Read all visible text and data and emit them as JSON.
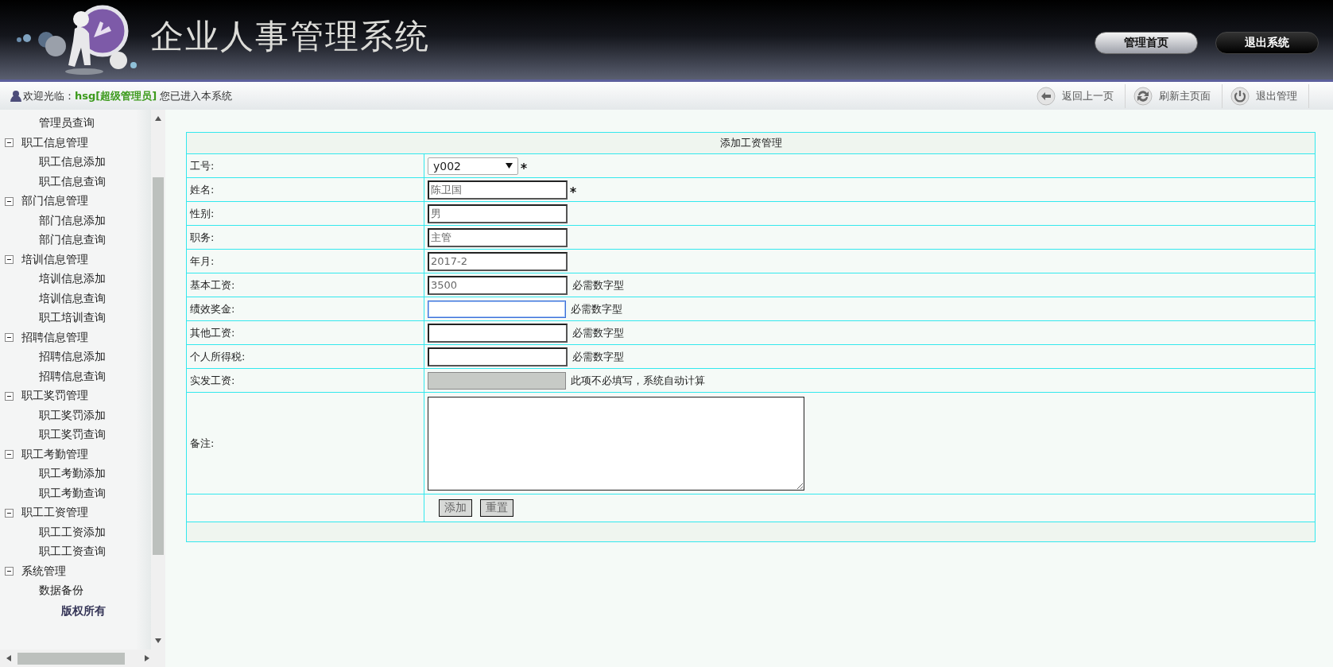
{
  "header": {
    "title": "企业人事管理系统",
    "nav_buttons": [
      {
        "label": "管理首页",
        "kind": "light"
      },
      {
        "label": "退出系统",
        "kind": "dark"
      }
    ]
  },
  "welcome": {
    "greeting": "欢迎光临：",
    "user": "hsg",
    "role": "[超级管理员]",
    "message": "您已进入本系统"
  },
  "toolbar": [
    {
      "label": "返回上一页"
    },
    {
      "label": "刷新主页面"
    },
    {
      "label": "退出管理"
    }
  ],
  "sidebar": {
    "tree": [
      {
        "children": [
          {
            "label": "管理员查询"
          }
        ]
      },
      {
        "label": "职工信息管理",
        "expanded": true,
        "children": [
          {
            "label": "职工信息添加"
          },
          {
            "label": "职工信息查询"
          }
        ]
      },
      {
        "label": "部门信息管理",
        "expanded": true,
        "children": [
          {
            "label": "部门信息添加"
          },
          {
            "label": "部门信息查询"
          }
        ]
      },
      {
        "label": "培训信息管理",
        "expanded": true,
        "children": [
          {
            "label": "培训信息添加"
          },
          {
            "label": "培训信息查询"
          },
          {
            "label": "职工培训查询"
          }
        ]
      },
      {
        "label": "招聘信息管理",
        "expanded": true,
        "children": [
          {
            "label": "招聘信息添加"
          },
          {
            "label": "招聘信息查询"
          }
        ]
      },
      {
        "label": "职工奖罚管理",
        "expanded": true,
        "children": [
          {
            "label": "职工奖罚添加"
          },
          {
            "label": "职工奖罚查询"
          }
        ]
      },
      {
        "label": "职工考勤管理",
        "expanded": true,
        "children": [
          {
            "label": "职工考勤添加"
          },
          {
            "label": "职工考勤查询"
          }
        ]
      },
      {
        "label": "职工工资管理",
        "expanded": true,
        "children": [
          {
            "label": "职工工资添加"
          },
          {
            "label": "职工工资查询"
          }
        ]
      },
      {
        "label": "系统管理",
        "expanded": true,
        "children": [
          {
            "label": "数据备份"
          }
        ]
      }
    ],
    "footer": "版权所有"
  },
  "form": {
    "title": "添加工资管理",
    "rows": [
      {
        "label": "工号:",
        "kind": "select",
        "value": "y002",
        "required": true
      },
      {
        "label": "姓名:",
        "kind": "text",
        "value": "陈卫国",
        "required": true,
        "focused": false
      },
      {
        "label": "性别:",
        "kind": "text",
        "value": "男",
        "required": false,
        "focused": false
      },
      {
        "label": "职务:",
        "kind": "text",
        "value": "主管",
        "required": false,
        "focused": false
      },
      {
        "label": "年月:",
        "kind": "text",
        "value": "2017-2",
        "required": false,
        "focused": false
      },
      {
        "label": "基本工资:",
        "kind": "text",
        "value": "3500",
        "required": false,
        "focused": false,
        "hint": "必需数字型"
      },
      {
        "label": "绩效奖金:",
        "kind": "text",
        "required": false,
        "focused": true,
        "hint": "必需数字型"
      },
      {
        "label": "其他工资:",
        "kind": "text",
        "required": false,
        "focused": false,
        "hint": "必需数字型"
      },
      {
        "label": "个人所得税:",
        "kind": "text",
        "required": false,
        "focused": false,
        "hint": "必需数字型"
      },
      {
        "label": "实发工资:",
        "kind": "disabled",
        "hint": "此项不必填写，系统自动计算"
      },
      {
        "label": "备注:",
        "kind": "textarea"
      }
    ],
    "buttons": [
      "添加",
      "重置"
    ]
  }
}
